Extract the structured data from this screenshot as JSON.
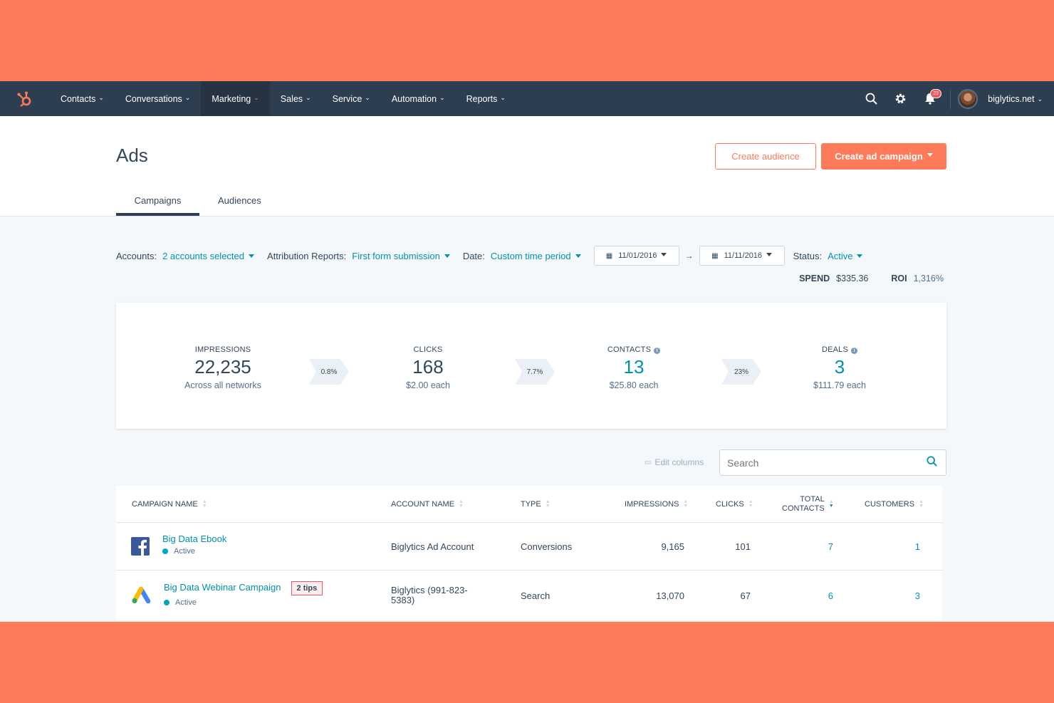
{
  "nav": {
    "items": [
      {
        "label": "Contacts"
      },
      {
        "label": "Conversations"
      },
      {
        "label": "Marketing"
      },
      {
        "label": "Sales"
      },
      {
        "label": "Service"
      },
      {
        "label": "Automation"
      },
      {
        "label": "Reports"
      }
    ],
    "notifications_count": "23",
    "account": "biglytics.net"
  },
  "page": {
    "title": "Ads",
    "create_audience_label": "Create audience",
    "create_campaign_label": "Create ad campaign",
    "tabs": [
      {
        "label": "Campaigns"
      },
      {
        "label": "Audiences"
      }
    ]
  },
  "filters": {
    "accounts_label": "Accounts:",
    "accounts_value": "2 accounts selected",
    "attribution_label": "Attribution Reports:",
    "attribution_value": "First form submission",
    "date_label": "Date:",
    "date_value": "Custom time period",
    "date_from": "11/01/2016",
    "date_to": "11/11/2016",
    "status_label": "Status:",
    "status_value": "Active"
  },
  "summary": {
    "spend_label": "SPEND",
    "spend_value": "$335.36",
    "roi_label": "ROI",
    "roi_value": "1,316%"
  },
  "funnel": {
    "metrics": [
      {
        "label": "IMPRESSIONS",
        "value": "22,235",
        "sub": "Across all networks"
      },
      {
        "label": "CLICKS",
        "value": "168",
        "sub": "$2.00 each"
      },
      {
        "label": "CONTACTS",
        "value": "13",
        "sub": "$25.80 each"
      },
      {
        "label": "DEALS",
        "value": "3",
        "sub": "$111.79 each"
      }
    ],
    "rates": [
      "0.8%",
      "7.7%",
      "23%"
    ]
  },
  "table_tools": {
    "edit_columns_label": "Edit columns",
    "search_placeholder": "Search"
  },
  "table": {
    "headers": [
      "CAMPAIGN NAME",
      "ACCOUNT NAME",
      "TYPE",
      "IMPRESSIONS",
      "CLICKS",
      "TOTAL",
      "CONTACTS",
      "CUSTOMERS"
    ],
    "rows": [
      {
        "campaign": "Big Data Ebook",
        "status": "Active",
        "account": "Biglytics Ad Account",
        "type": "Conversions",
        "impressions": "9,165",
        "clicks": "101",
        "contacts": "7",
        "customers": "1",
        "network": "facebook-icon"
      },
      {
        "campaign": "Big Data Webinar Campaign",
        "tips": "2 tips",
        "status": "Active",
        "account_line1": "Biglytics (991-823-",
        "account_line2": "5383)",
        "type": "Search",
        "impressions": "13,070",
        "clicks": "67",
        "contacts": "6",
        "customers": "3",
        "network": "google-ads-icon"
      }
    ]
  },
  "colors": {
    "accent": "#ff7a59",
    "nav_bg": "#2d3e50",
    "link": "#0091ae"
  }
}
